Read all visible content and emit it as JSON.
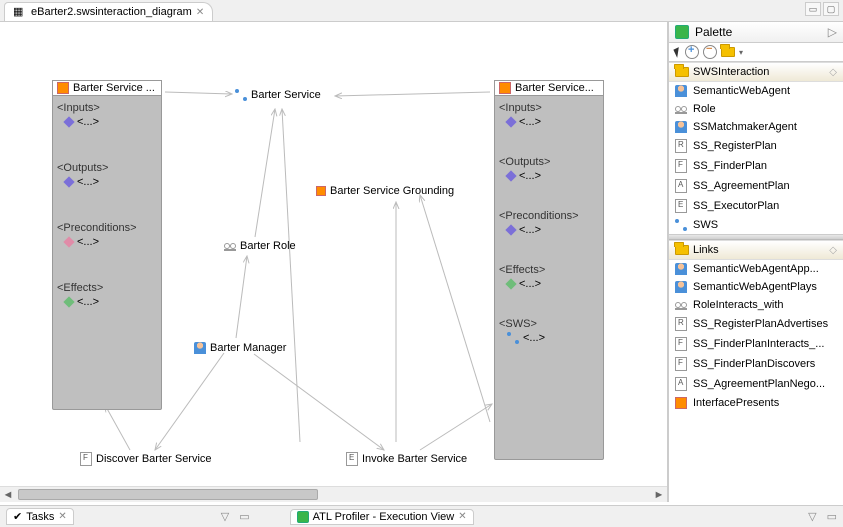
{
  "tab": {
    "title": "eBarter2.swsinteraction_diagram"
  },
  "window_controls": {
    "minimize": "▭",
    "maximize": "▢"
  },
  "left_box": {
    "title": "Barter Service ...",
    "sections": [
      {
        "title": "<Inputs>",
        "item": "<...>",
        "diamond": "purple"
      },
      {
        "title": "<Outputs>",
        "item": "<...>",
        "diamond": "purple"
      },
      {
        "title": "<Preconditions>",
        "item": "<...>",
        "diamond": "pink"
      },
      {
        "title": "<Effects>",
        "item": "<...>",
        "diamond": "green"
      }
    ]
  },
  "right_box": {
    "title": "Barter Service...",
    "sections": [
      {
        "title": "<Inputs>",
        "item": "<...>",
        "diamond": "purple"
      },
      {
        "title": "<Outputs>",
        "item": "<...>",
        "diamond": "purple"
      },
      {
        "title": "<Preconditions>",
        "item": "<...>",
        "diamond": "purple"
      },
      {
        "title": "<Effects>",
        "item": "<...>",
        "diamond": "green"
      },
      {
        "title": "<SWS>",
        "item": "<...>",
        "diamond": "connect"
      }
    ]
  },
  "nodes": {
    "service": "Barter Service",
    "grounding": "Barter Service  Grounding",
    "role": "Barter Role",
    "manager": "Barter Manager",
    "discover": "Discover Barter Service",
    "invoke": "Invoke Barter Service"
  },
  "palette": {
    "title": "Palette",
    "groups": [
      {
        "title": "SWSInteraction",
        "items": [
          {
            "label": "SemanticWebAgent",
            "icon": "person"
          },
          {
            "label": "Role",
            "icon": "mask"
          },
          {
            "label": "SSMatchmakerAgent",
            "icon": "person"
          },
          {
            "label": "SS_RegisterPlan",
            "icon": "file-r"
          },
          {
            "label": "SS_FinderPlan",
            "icon": "file-f"
          },
          {
            "label": "SS_AgreementPlan",
            "icon": "file-a"
          },
          {
            "label": "SS_ExecutorPlan",
            "icon": "file-e"
          },
          {
            "label": "SWS",
            "icon": "connect"
          }
        ]
      },
      {
        "title": "Links",
        "items": [
          {
            "label": "SemanticWebAgentApp...",
            "icon": "person"
          },
          {
            "label": "SemanticWebAgentPlays",
            "icon": "person"
          },
          {
            "label": "RoleInteracts_with",
            "icon": "mask"
          },
          {
            "label": "SS_RegisterPlanAdvertises",
            "icon": "file-r"
          },
          {
            "label": "SS_FinderPlanInteracts_...",
            "icon": "file-f"
          },
          {
            "label": "SS_FinderPlanDiscovers",
            "icon": "file-f"
          },
          {
            "label": "SS_AgreementPlanNego...",
            "icon": "file-a"
          },
          {
            "label": "InterfacePresents",
            "icon": "orange"
          }
        ]
      }
    ]
  },
  "bottom": {
    "tasks": "Tasks",
    "atl": "ATL Profiler - Execution View"
  }
}
